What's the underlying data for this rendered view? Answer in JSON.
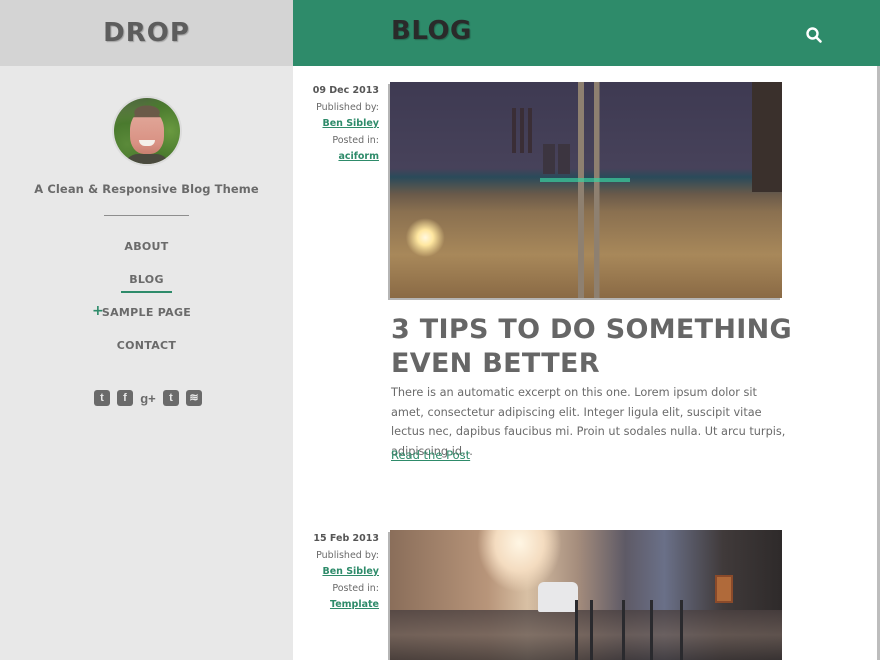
{
  "site": {
    "title": "DROP",
    "tagline": "A Clean & Responsive Blog Theme",
    "accent_color": "#2e8b6a"
  },
  "nav": {
    "items": [
      {
        "label": "ABOUT",
        "current": false,
        "has_children": false
      },
      {
        "label": "BLOG",
        "current": true,
        "has_children": false
      },
      {
        "label": "SAMPLE PAGE",
        "current": false,
        "has_children": true
      },
      {
        "label": "CONTACT",
        "current": false,
        "has_children": false
      }
    ],
    "expand_icon": "+"
  },
  "social": [
    {
      "name": "twitter-icon",
      "glyph": "t"
    },
    {
      "name": "facebook-icon",
      "glyph": "f"
    },
    {
      "name": "google-plus-icon",
      "glyph": "g+"
    },
    {
      "name": "tumblr-icon",
      "glyph": "t"
    },
    {
      "name": "rss-icon",
      "glyph": "≋"
    }
  ],
  "header": {
    "page_heading": "BLOG",
    "search_icon": "search-icon"
  },
  "posts": [
    {
      "date": "09 Dec 2013",
      "published_by_label": "Published by:",
      "author": "Ben Sibley",
      "posted_in_label": "Posted in:",
      "category": "aciform",
      "title": "3 TIPS TO DO SOMETHING EVEN BETTER",
      "excerpt": "There is an automatic excerpt on this one. Lorem ipsum dolor sit amet, consectetur adipiscing elit. Integer ligula elit, suscipit vitae lectus nec, dapibus faucibus mi. Proin ut sodales nulla. Ut arcu turpis, adipiscing id...",
      "read_more": "Read the Post",
      "image_alt": "Railway tracks at night with industrial chimneys"
    },
    {
      "date": "15 Feb 2013",
      "published_by_label": "Published by:",
      "author": "Ben Sibley",
      "posted_in_label": "Posted in:",
      "category": "Template",
      "image_alt": "City street with bicycle rack in morning light"
    }
  ]
}
